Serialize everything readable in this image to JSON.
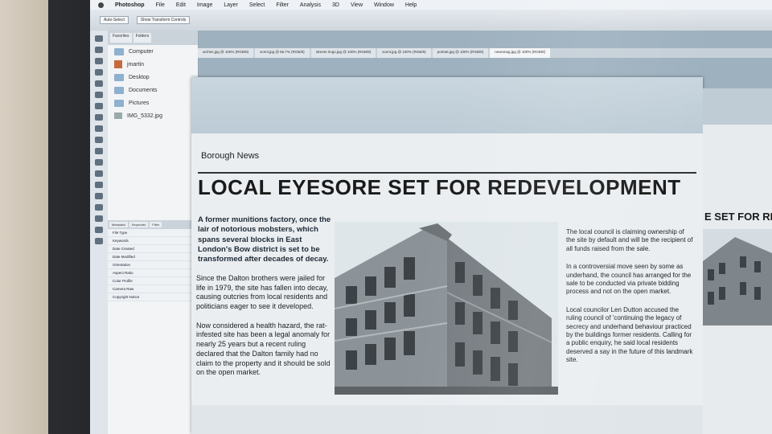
{
  "menubar": {
    "app_name": "Photoshop",
    "items": [
      "File",
      "Edit",
      "Image",
      "Layer",
      "Select",
      "Filter",
      "Analysis",
      "3D",
      "View",
      "Window",
      "Help"
    ]
  },
  "options": {
    "items": [
      "Auto-Select",
      "Show Transform Controls"
    ]
  },
  "bridge": {
    "tabs": [
      "Favorites",
      "Folders"
    ],
    "favorites": [
      "Computer",
      "jmartin",
      "Desktop",
      "Documents",
      "Pictures",
      "IMG_5332.jpg"
    ],
    "meta_tabs": [
      "Metadata",
      "Keywords",
      "Filter"
    ],
    "metadata_rows": [
      "File Type",
      "Keywords",
      "Date Created",
      "Date Modified",
      "Orientation",
      "Aspect Ratio",
      "Color Profile",
      "Camera Raw",
      "Copyright Notice"
    ]
  },
  "document_tabs": [
    "arches.jpg @ 100% (RGB/8)",
    "scent.jpg @ 66.7% (RGB/8)",
    "streets-ringo.jpg @ 100% (RGB/8)",
    "scent.jpg @ 100% (RGB/8)",
    "portrait.jpg @ 100% (RGB/8)",
    "newsmag.jpg @ 100% (RGB/8)"
  ],
  "article": {
    "section": "Borough News",
    "headline": "LOCAL EYESORE SET FOR REDEVELOPMENT",
    "lead": "A former munitions factory, once the lair of notorious mobsters, which spans several blocks in East London's Bow district is set to be transformed after decades of decay.",
    "left_paragraphs": [
      "Since the Dalton brothers were jailed for life in 1979, the site has fallen into decay, causing outcries from local residents and politicians eager to see it developed.",
      "Now considered a health hazard, the rat-infested site has been a legal anomaly for nearly 25 years but a recent ruling declared that the Dalton family had no claim to the property and it should be sold on the open market."
    ],
    "right_paragraphs": [
      "The local council is claiming ownership of the site by default and will be the recipient of all funds raised from the sale.",
      "In a controversial move seen by some as underhand, the council has arranged for the sale to be conducted via private bidding process and not on the open market.",
      "Local councilor Len Dutton accused the ruling council of 'continuing the legacy of secrecy and underhand behaviour practiced by the buildings former residents. Calling for a public enquiry, he said local residents deserved a say in the future of this landmark site."
    ]
  },
  "right_doc": {
    "headline_fragment": "E SET FOR RED"
  }
}
